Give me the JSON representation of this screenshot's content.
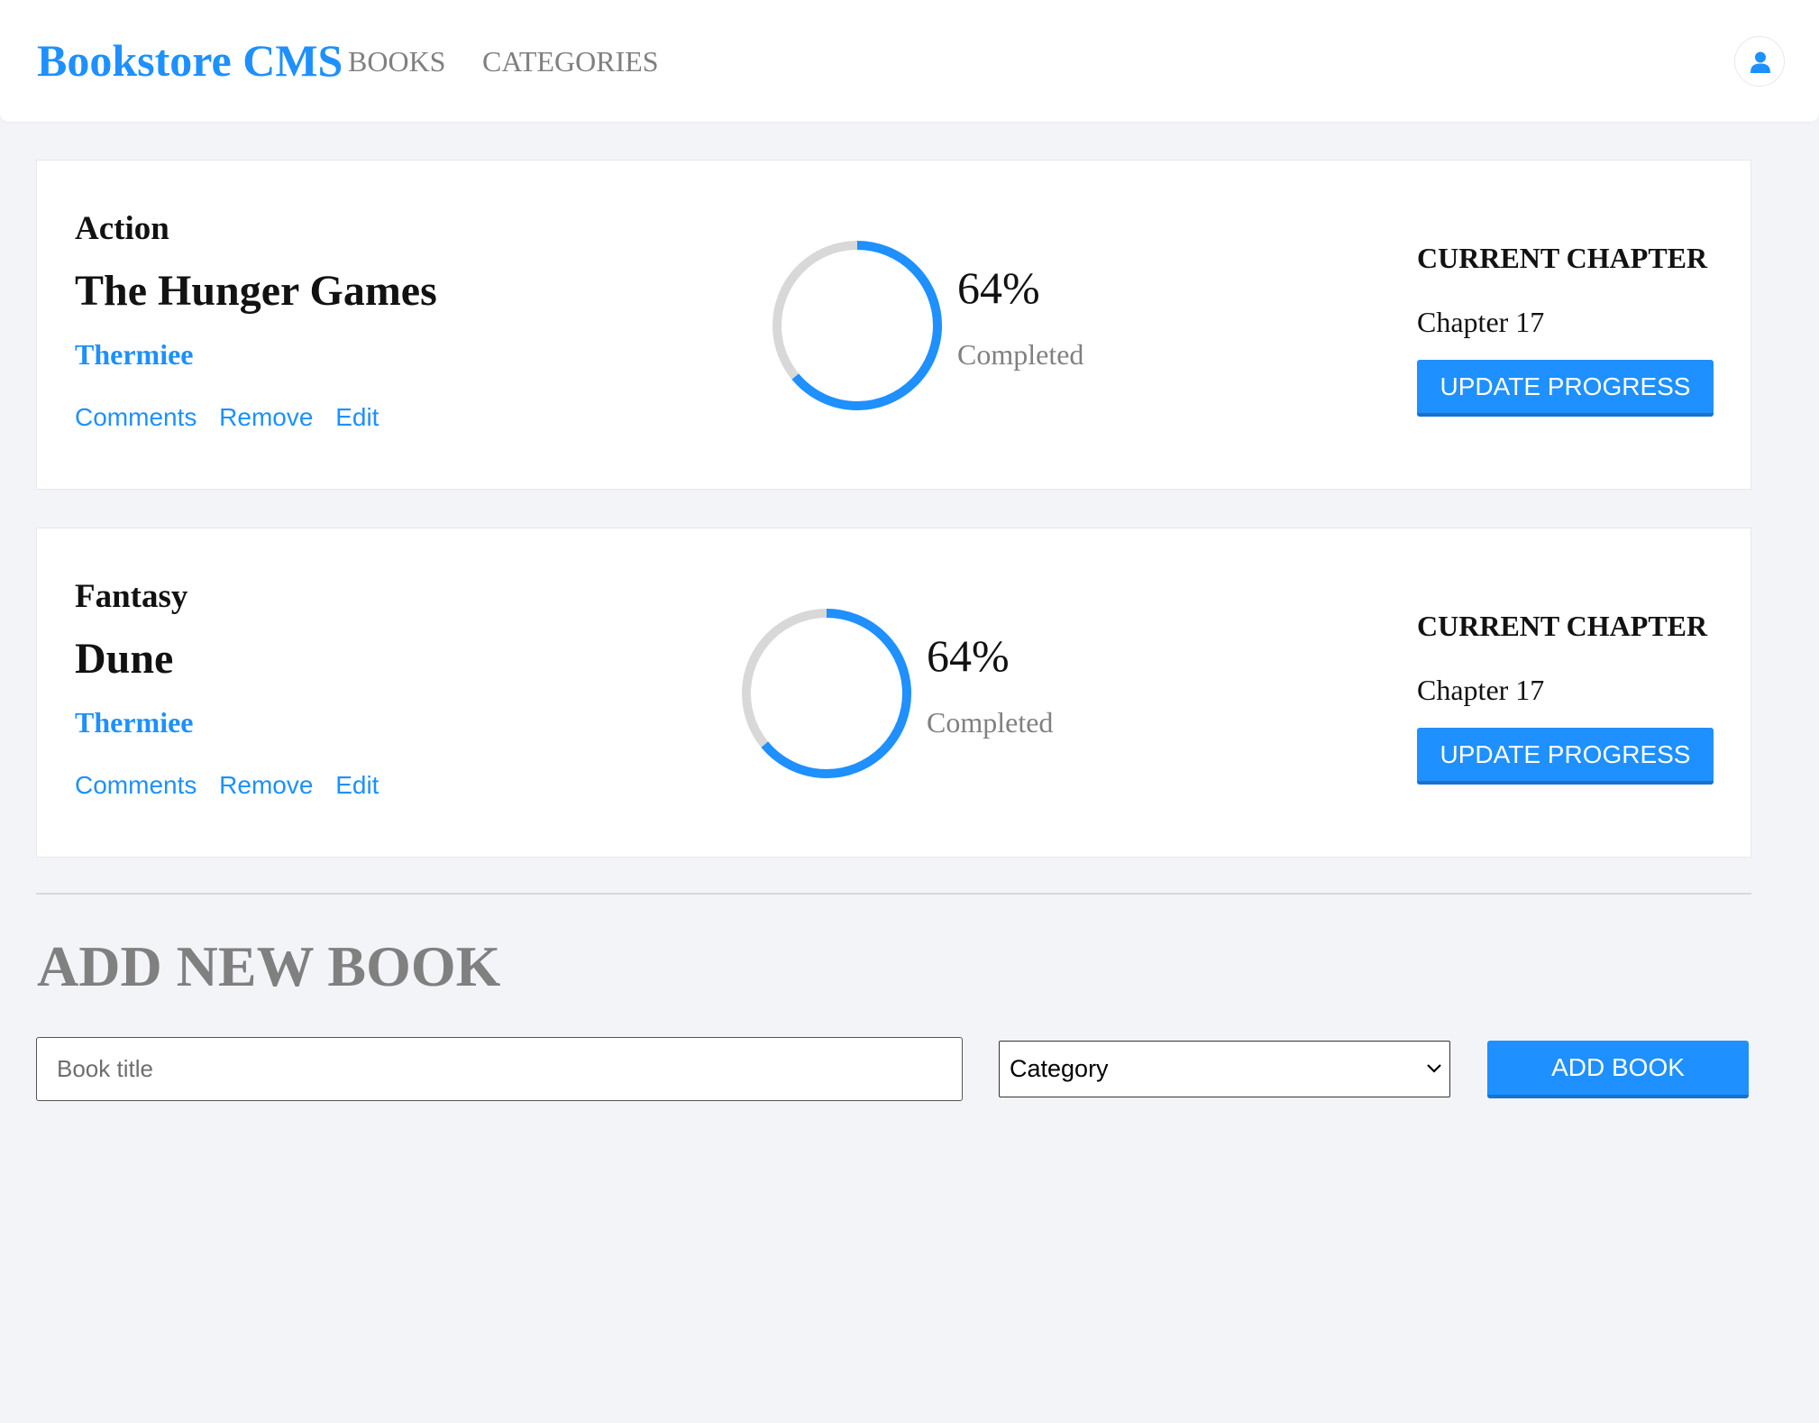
{
  "header": {
    "logo": "Bookstore CMS",
    "nav": [
      {
        "label": "BOOKS"
      },
      {
        "label": "CATEGORIES"
      }
    ],
    "user_icon": "user-icon"
  },
  "books": [
    {
      "category": "Action",
      "title": "The Hunger Games",
      "author": "Thermiee",
      "actions": [
        "Comments",
        "Remove",
        "Edit"
      ],
      "progress_percent": 64,
      "percent_label": "64%",
      "completed_label": "Completed",
      "chapter_heading": "CURRENT CHAPTER",
      "chapter": "Chapter 17",
      "update_label": "UPDATE PROGRESS"
    },
    {
      "category": "Fantasy",
      "title": "Dune",
      "author": "Thermiee",
      "actions": [
        "Comments",
        "Remove",
        "Edit"
      ],
      "progress_percent": 64,
      "percent_label": "64%",
      "completed_label": "Completed",
      "chapter_heading": "CURRENT CHAPTER",
      "chapter": "Chapter 17",
      "update_label": "UPDATE PROGRESS"
    }
  ],
  "add_form": {
    "heading": "ADD NEW BOOK",
    "title_placeholder": "Book title",
    "title_value": "",
    "category_selected": "Category",
    "submit_label": "ADD BOOK"
  },
  "colors": {
    "accent": "#1e90ff",
    "accent_dark": "#1873cc",
    "background": "#f3f4f7",
    "muted": "#808080",
    "ring_track": "#d8d8d8"
  }
}
